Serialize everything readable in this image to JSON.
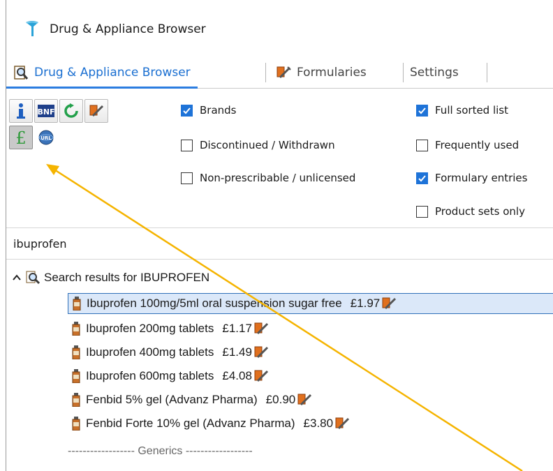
{
  "window": {
    "title": "Drug & Appliance Browser"
  },
  "tabs": [
    {
      "label": "Drug & Appliance Browser",
      "icon": "magnifier-icon",
      "active": true
    },
    {
      "label": "Formularies",
      "icon": "syringe-icon",
      "active": false
    },
    {
      "label": "Settings",
      "icon": "",
      "active": false
    }
  ],
  "toolbar": {
    "buttons": [
      {
        "name": "info-icon"
      },
      {
        "name": "bnf-icon",
        "text": "BNF"
      },
      {
        "name": "refresh-icon"
      },
      {
        "name": "formulary-icon"
      },
      {
        "name": "pound-icon",
        "text": "£",
        "pressed": true
      },
      {
        "name": "url-globe-icon",
        "text": "URL"
      }
    ],
    "checkboxes": {
      "brands": {
        "label": "Brands",
        "checked": true
      },
      "discontinued": {
        "label": "Discontinued / Withdrawn",
        "checked": false
      },
      "non_prescribable": {
        "label": "Non-prescribable / unlicensed",
        "checked": false
      },
      "full_sorted": {
        "label": "Full sorted list",
        "checked": true
      },
      "frequently_used": {
        "label": "Frequently used",
        "checked": false
      },
      "formulary_entries": {
        "label": "Formulary entries",
        "checked": true
      },
      "product_sets": {
        "label": "Product sets only",
        "checked": false
      }
    }
  },
  "search": {
    "value": "ibuprofen"
  },
  "results": {
    "header": "Search results for IBUPROFEN",
    "items": [
      {
        "name": "Ibuprofen 100mg/5ml oral suspension sugar free",
        "price": "£1.97",
        "selected": true
      },
      {
        "name": "Ibuprofen 200mg tablets",
        "price": "£1.17"
      },
      {
        "name": "Ibuprofen 400mg tablets",
        "price": "£1.49"
      },
      {
        "name": "Ibuprofen 600mg tablets",
        "price": "£4.08"
      },
      {
        "name": "Fenbid 5% gel (Advanz Pharma)",
        "price": "£0.90"
      },
      {
        "name": "Fenbid Forte 10% gel (Advanz Pharma)",
        "price": "£3.80"
      }
    ],
    "generics_separator": "------------------ Generics ------------------"
  },
  "colors": {
    "accent": "#1e73d8",
    "annotation_arrow": "#f5b400",
    "pound_green": "#2f9a3a"
  }
}
